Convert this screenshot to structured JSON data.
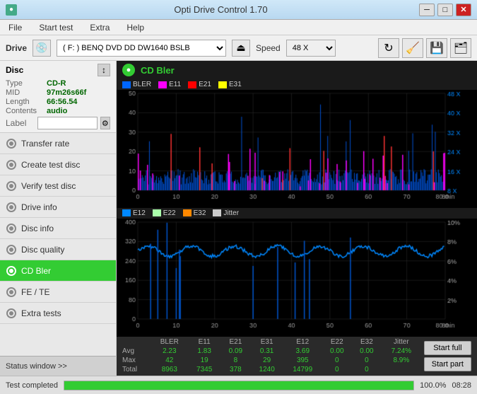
{
  "app": {
    "title": "Opti Drive Control 1.70",
    "icon": "●"
  },
  "titlebar": {
    "minimize_label": "─",
    "maximize_label": "□",
    "close_label": "✕"
  },
  "menu": {
    "items": [
      "File",
      "Start test",
      "Extra",
      "Help"
    ]
  },
  "drive": {
    "label": "Drive",
    "drive_value": "(F:)  BENQ DVD DD DW1640 BSLB",
    "speed_label": "Speed",
    "speed_value": "48 X"
  },
  "disc": {
    "title": "Disc",
    "type_label": "Type",
    "type_value": "CD-R",
    "mid_label": "MID",
    "mid_value": "97m26s66f",
    "length_label": "Length",
    "length_value": "66:56.54",
    "contents_label": "Contents",
    "contents_value": "audio",
    "label_label": "Label",
    "label_placeholder": ""
  },
  "sidebar_nav": [
    {
      "id": "transfer-rate",
      "label": "Transfer rate",
      "active": false
    },
    {
      "id": "create-test-disc",
      "label": "Create test disc",
      "active": false
    },
    {
      "id": "verify-test-disc",
      "label": "Verify test disc",
      "active": false
    },
    {
      "id": "drive-info",
      "label": "Drive info",
      "active": false
    },
    {
      "id": "disc-info",
      "label": "Disc info",
      "active": false
    },
    {
      "id": "disc-quality",
      "label": "Disc quality",
      "active": false
    },
    {
      "id": "cd-bler",
      "label": "CD Bler",
      "active": true
    },
    {
      "id": "fe-te",
      "label": "FE / TE",
      "active": false
    },
    {
      "id": "extra-tests",
      "label": "Extra tests",
      "active": false
    }
  ],
  "status_window": {
    "label": "Status window >>"
  },
  "chart": {
    "title": "CD Bler",
    "top_legend": [
      {
        "label": "BLER",
        "color": "#0066ff"
      },
      {
        "label": "E11",
        "color": "#ff00ff"
      },
      {
        "label": "E21",
        "color": "#ff0000"
      },
      {
        "label": "E31",
        "color": "#ffff00"
      }
    ],
    "bottom_legend": [
      {
        "label": "E12",
        "color": "#0088ff"
      },
      {
        "label": "E22",
        "color": "#aaffaa"
      },
      {
        "label": "E32",
        "color": "#ff8800"
      },
      {
        "label": "Jitter",
        "color": "#cccccc"
      }
    ]
  },
  "stats": {
    "columns": [
      "BLER",
      "E11",
      "E21",
      "E31",
      "E12",
      "E22",
      "E32",
      "Jitter"
    ],
    "rows": [
      {
        "label": "Avg",
        "values": [
          "2.23",
          "1.83",
          "0.09",
          "0.31",
          "3.69",
          "0.00",
          "0.00",
          "7.24%"
        ]
      },
      {
        "label": "Max",
        "values": [
          "42",
          "19",
          "8",
          "29",
          "395",
          "0",
          "0",
          "8.9%"
        ]
      },
      {
        "label": "Total",
        "values": [
          "8963",
          "7345",
          "378",
          "1240",
          "14799",
          "0",
          "0",
          ""
        ]
      }
    ],
    "buttons": {
      "start_full": "Start full",
      "start_part": "Start part"
    }
  },
  "statusbar": {
    "text": "Test completed",
    "progress": 100,
    "percent": "100.0%",
    "time": "08:28"
  }
}
